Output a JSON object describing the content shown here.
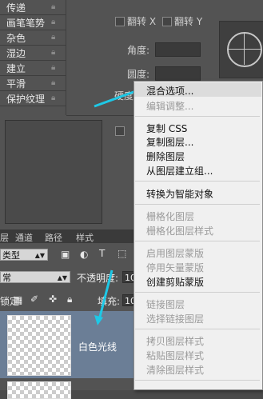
{
  "brush_options": [
    {
      "label": "传递"
    },
    {
      "label": "画笔笔势"
    },
    {
      "label": "杂色"
    },
    {
      "label": "湿边"
    },
    {
      "label": "建立"
    },
    {
      "label": "平滑"
    },
    {
      "label": "保护纹理"
    }
  ],
  "flip_x_label": "翻转 X",
  "flip_y_label": "翻转 Y",
  "angle_label": "角度:",
  "roundness_label": "圆度:",
  "hardness_label_partial": "硬度",
  "layers_tabs": [
    "层",
    "通道",
    "路径",
    "样式"
  ],
  "filter": {
    "kind_value": "类型"
  },
  "blend": {
    "mode_value": "常",
    "opacity_label": "不透明度:",
    "opacity_value": "10"
  },
  "lock": {
    "label": "锁定:",
    "fill_label": "填充:",
    "fill_value": "10"
  },
  "layer": {
    "name": "白色光线"
  },
  "context_menu": {
    "items": [
      {
        "label": "混合选项...",
        "enabled": true
      },
      {
        "label": "编辑调整...",
        "enabled": false
      },
      {
        "label": "复制 CSS",
        "enabled": true
      },
      {
        "label": "复制图层...",
        "enabled": true
      },
      {
        "label": "删除图层",
        "enabled": true
      },
      {
        "label": "从图层建立组...",
        "enabled": true
      },
      {
        "label": "转换为智能对象",
        "enabled": true
      },
      {
        "label": "栅格化图层",
        "enabled": false
      },
      {
        "label": "栅格化图层样式",
        "enabled": false
      },
      {
        "label": "启用图层蒙版",
        "enabled": false
      },
      {
        "label": "停用矢量蒙版",
        "enabled": false
      },
      {
        "label": "创建剪贴蒙版",
        "enabled": true
      },
      {
        "label": "链接图层",
        "enabled": false
      },
      {
        "label": "选择链接图层",
        "enabled": false
      },
      {
        "label": "拷贝图层样式",
        "enabled": false
      },
      {
        "label": "粘贴图层样式",
        "enabled": false
      },
      {
        "label": "清除图层样式",
        "enabled": false
      }
    ]
  },
  "colors": {
    "arrow": "#1ec8e6",
    "selected_layer": "#6b7e96",
    "menu_bg": "#f0f0f0"
  }
}
